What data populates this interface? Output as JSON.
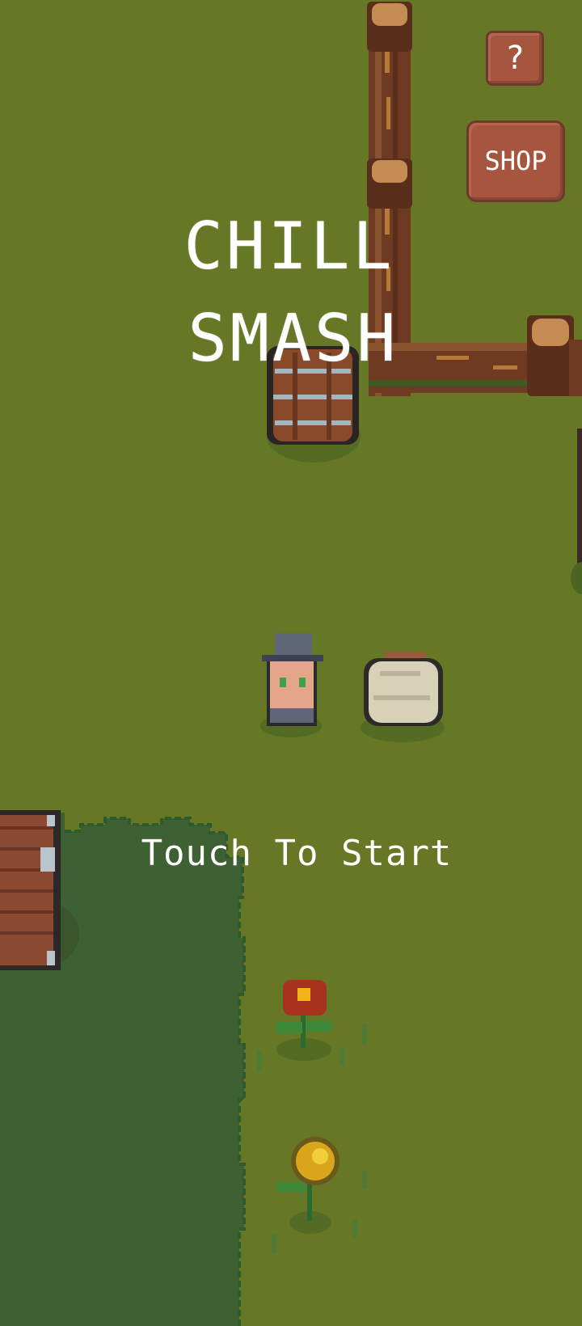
{
  "game": {
    "title_line1": "CHILL",
    "title_line2": "SMASH",
    "prompt": "Touch To Start"
  },
  "hud": {
    "help_label": "?",
    "shop_label": "SHOP",
    "exit_icon": "exit-door-icon"
  },
  "colors": {
    "grass": "#667826",
    "dark_grass": "#3f6331",
    "button": "#a6553f",
    "fence": "#6e3b22",
    "text": "#ffffff"
  }
}
